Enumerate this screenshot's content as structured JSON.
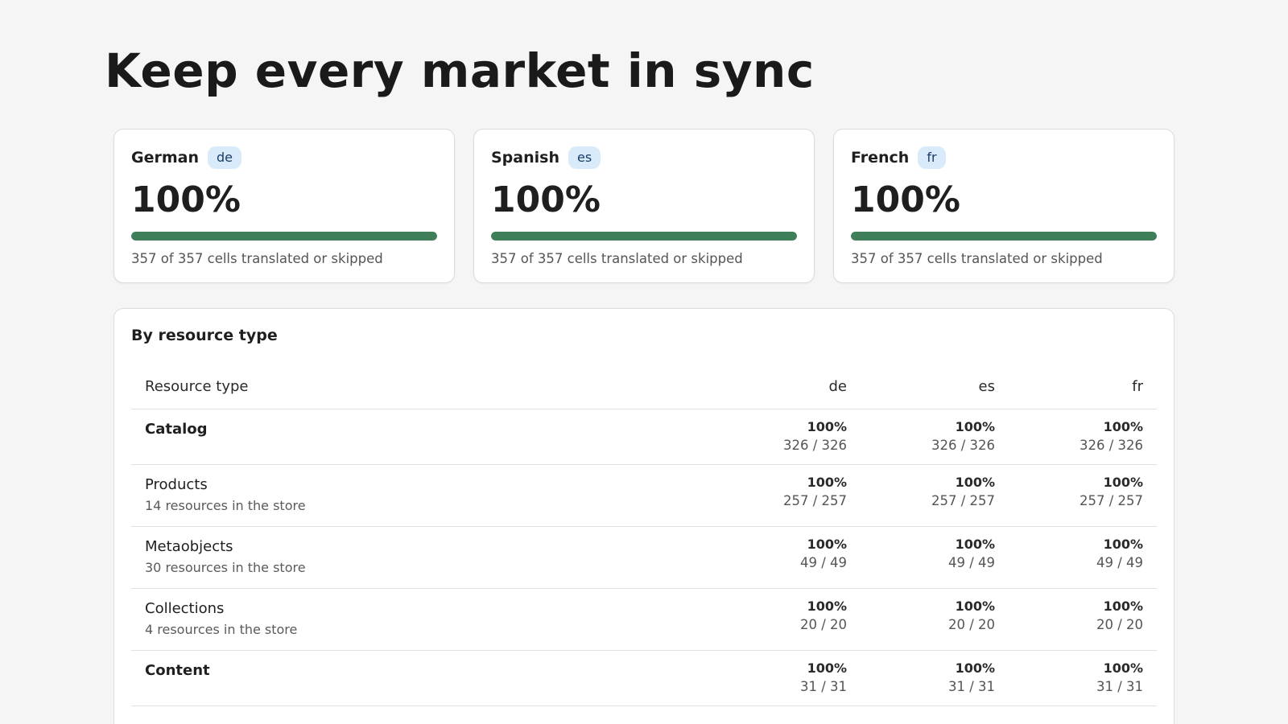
{
  "page": {
    "title": "Keep every market in sync"
  },
  "languages": [
    {
      "name": "German",
      "code": "de",
      "percent": "100%",
      "progress": 1.0,
      "summary": "357 of 357 cells translated or skipped"
    },
    {
      "name": "Spanish",
      "code": "es",
      "percent": "100%",
      "progress": 1.0,
      "summary": "357 of 357 cells translated or skipped"
    },
    {
      "name": "French",
      "code": "fr",
      "percent": "100%",
      "progress": 1.0,
      "summary": "357 of 357 cells translated or skipped"
    }
  ],
  "resource_table": {
    "heading": "By resource type",
    "columns": [
      "Resource type",
      "de",
      "es",
      "fr"
    ],
    "rows": [
      {
        "name": "Catalog",
        "sub": "",
        "group": true,
        "values": [
          {
            "pct": "100%",
            "count": "326 / 326"
          },
          {
            "pct": "100%",
            "count": "326 / 326"
          },
          {
            "pct": "100%",
            "count": "326 / 326"
          }
        ]
      },
      {
        "name": "Products",
        "sub": "14 resources in the store",
        "group": false,
        "values": [
          {
            "pct": "100%",
            "count": "257 / 257"
          },
          {
            "pct": "100%",
            "count": "257 / 257"
          },
          {
            "pct": "100%",
            "count": "257 / 257"
          }
        ]
      },
      {
        "name": "Metaobjects",
        "sub": "30 resources in the store",
        "group": false,
        "values": [
          {
            "pct": "100%",
            "count": "49 / 49"
          },
          {
            "pct": "100%",
            "count": "49 / 49"
          },
          {
            "pct": "100%",
            "count": "49 / 49"
          }
        ]
      },
      {
        "name": "Collections",
        "sub": "4 resources in the store",
        "group": false,
        "values": [
          {
            "pct": "100%",
            "count": "20 / 20"
          },
          {
            "pct": "100%",
            "count": "20 / 20"
          },
          {
            "pct": "100%",
            "count": "20 / 20"
          }
        ]
      },
      {
        "name": "Content",
        "sub": "",
        "group": true,
        "values": [
          {
            "pct": "100%",
            "count": "31 / 31"
          },
          {
            "pct": "100%",
            "count": "31 / 31"
          },
          {
            "pct": "100%",
            "count": "31 / 31"
          }
        ]
      }
    ]
  },
  "colors": {
    "progress_fill": "#3e7e58",
    "badge_bg": "#d9ebfb",
    "background": "#f5f5f5"
  }
}
